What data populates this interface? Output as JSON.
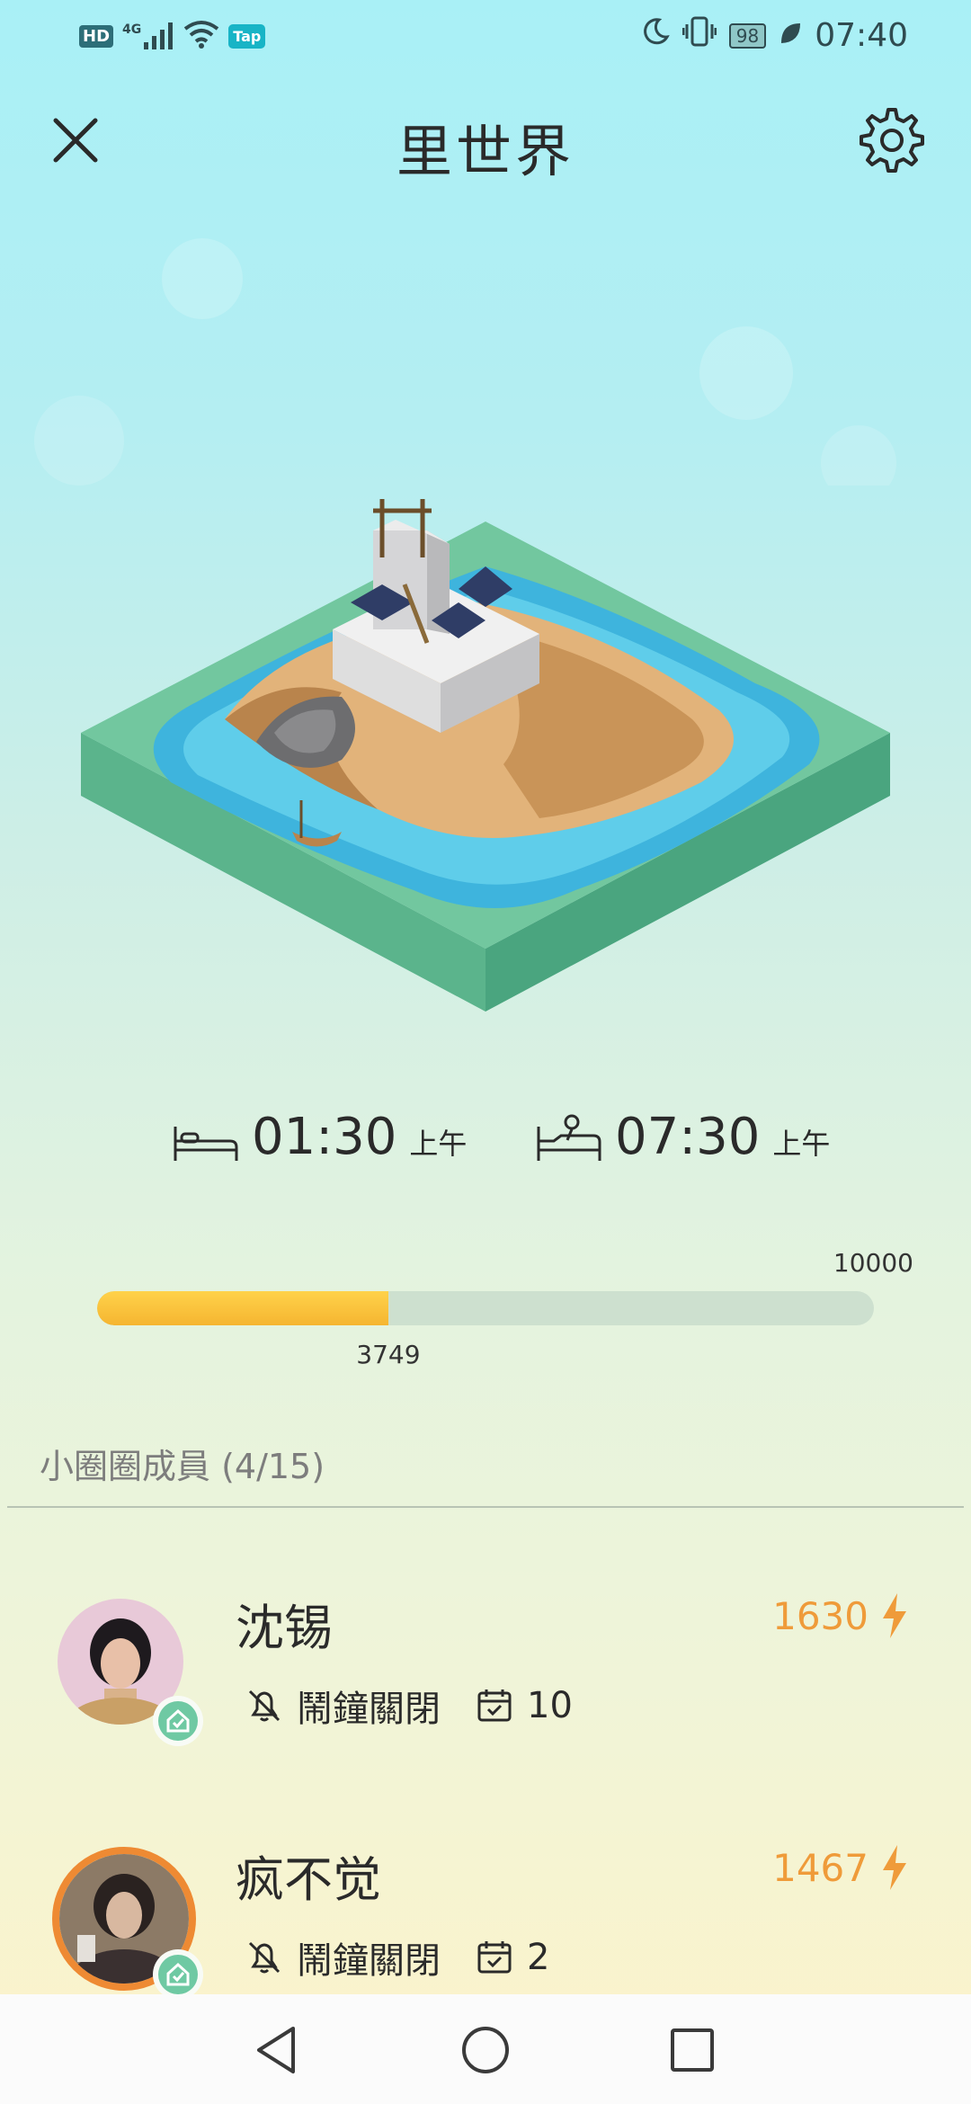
{
  "status_bar": {
    "hd_label": "HD",
    "network_label": "4G",
    "app_badge": "Tap",
    "battery": "98",
    "time": "07:40"
  },
  "header": {
    "title": "里世界"
  },
  "schedule": {
    "sleep_time": "01:30",
    "sleep_ampm": "上午",
    "wake_time": "07:30",
    "wake_ampm": "上午"
  },
  "progress": {
    "current": "3749",
    "max": "10000",
    "fraction": 0.3749
  },
  "members": {
    "title": "小圈圈成員 (4/15)",
    "items": [
      {
        "name": "沈锡",
        "score": "1630",
        "alarm": "鬧鐘關閉",
        "days": "10"
      },
      {
        "name": "疯不觉",
        "score": "1467",
        "alarm": "鬧鐘關閉",
        "days": "2"
      }
    ]
  },
  "colors": {
    "accent_orange": "#ef9b3a",
    "progress_fill": "#f5b531",
    "verified_green": "#6fc9a3"
  }
}
